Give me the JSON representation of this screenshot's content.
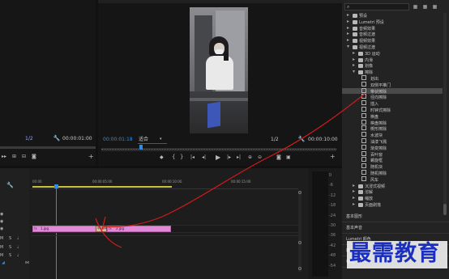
{
  "colors": {
    "accent": "#2d8ceb",
    "clip": "#e08ad8",
    "clip_dark": "#c46bbb",
    "annotation": "#e02020",
    "watermark": "#1a2fbf",
    "selection": "#4a4a4a"
  },
  "source_monitor": {
    "zoom": "1/2",
    "timecode": "00:00:01:00"
  },
  "program_monitor": {
    "current_time": "00:00:01:18",
    "fit": "适合",
    "zoom": "1/2",
    "duration": "00:00:10:00"
  },
  "effects": {
    "search_placeholder": "",
    "items": [
      {
        "label": "预设",
        "type": "folder",
        "indent": 0,
        "expanded": false
      },
      {
        "label": "Lumetri 预设",
        "type": "folder",
        "indent": 0,
        "expanded": false
      },
      {
        "label": "音频效果",
        "type": "folder",
        "indent": 0,
        "expanded": false
      },
      {
        "label": "音频过渡",
        "type": "folder",
        "indent": 0,
        "expanded": false
      },
      {
        "label": "视频效果",
        "type": "folder",
        "indent": 0,
        "expanded": false
      },
      {
        "label": "视频过渡",
        "type": "folder",
        "indent": 0,
        "expanded": true
      },
      {
        "label": "3D 运动",
        "type": "folder",
        "indent": 1,
        "expanded": false
      },
      {
        "label": "内滑",
        "type": "folder",
        "indent": 1,
        "expanded": false
      },
      {
        "label": "划像",
        "type": "folder",
        "indent": 1,
        "expanded": false
      },
      {
        "label": "擦除",
        "type": "folder",
        "indent": 1,
        "expanded": true
      },
      {
        "label": "划出",
        "type": "effect",
        "indent": 2
      },
      {
        "label": "双侧平推门",
        "type": "effect",
        "indent": 2
      },
      {
        "label": "带状擦除",
        "type": "effect",
        "indent": 2,
        "selected": true
      },
      {
        "label": "径向擦除",
        "type": "effect",
        "indent": 2
      },
      {
        "label": "插入",
        "type": "effect",
        "indent": 2
      },
      {
        "label": "时钟式擦除",
        "type": "effect",
        "indent": 2
      },
      {
        "label": "棋盘",
        "type": "effect",
        "indent": 2
      },
      {
        "label": "棋盘擦除",
        "type": "effect",
        "indent": 2
      },
      {
        "label": "楔形擦除",
        "type": "effect",
        "indent": 2
      },
      {
        "label": "水波块",
        "type": "effect",
        "indent": 2
      },
      {
        "label": "油漆飞溅",
        "type": "effect",
        "indent": 2
      },
      {
        "label": "渐变擦除",
        "type": "effect",
        "indent": 2
      },
      {
        "label": "百叶窗",
        "type": "effect",
        "indent": 2
      },
      {
        "label": "螺旋框",
        "type": "effect",
        "indent": 2
      },
      {
        "label": "随机块",
        "type": "effect",
        "indent": 2
      },
      {
        "label": "随机擦除",
        "type": "effect",
        "indent": 2
      },
      {
        "label": "风车",
        "type": "effect",
        "indent": 2
      },
      {
        "label": "沉浸式视频",
        "type": "folder",
        "indent": 1,
        "expanded": false
      },
      {
        "label": "溶解",
        "type": "folder",
        "indent": 1,
        "expanded": false
      },
      {
        "label": "缩放",
        "type": "folder",
        "indent": 1,
        "expanded": false
      },
      {
        "label": "页面剥落",
        "type": "folder",
        "indent": 1,
        "expanded": false
      }
    ],
    "bottom_sections": [
      "基本图形",
      "基本声音",
      "Lumetri 颜色",
      "库",
      "标记"
    ]
  },
  "timeline": {
    "ruler": [
      "00:00",
      "00:00:05:00",
      "00:00:10:00",
      "00:00:15:00"
    ],
    "clips": [
      {
        "name": "1.jpg"
      },
      {
        "name": "2.jpg"
      }
    ],
    "transition_label": "带状擦除"
  },
  "audio_meter": {
    "levels": [
      "0",
      "-6",
      "-12",
      "-18",
      "-24",
      "-30",
      "-36",
      "-42",
      "-48",
      "-54"
    ]
  },
  "watermark": "最需教育"
}
